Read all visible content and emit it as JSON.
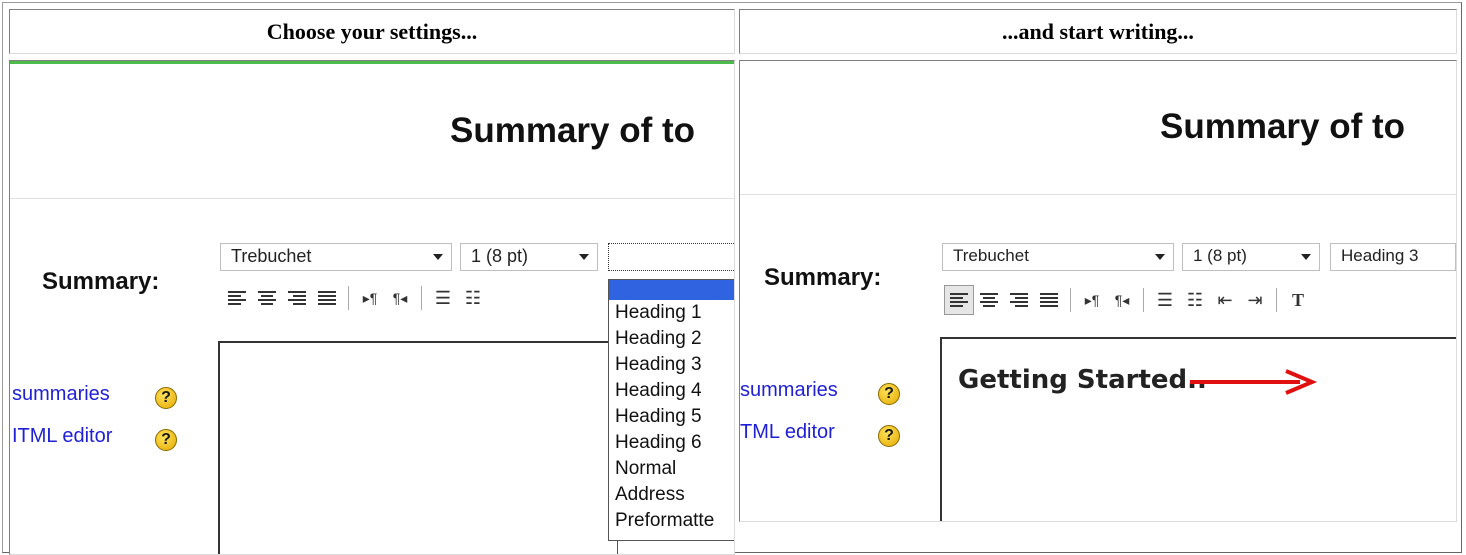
{
  "left_panel": {
    "header": "Choose your settings...",
    "page_title": "Summary of to",
    "field_label": "Summary:",
    "font_select": "Trebuchet",
    "size_select": "1 (8 pt)",
    "format_select": "",
    "links": [
      {
        "label": "summaries"
      },
      {
        "label": "ITML editor"
      }
    ],
    "help_icon_glyph": "?",
    "dropdown_options": [
      "",
      "Heading 1",
      "Heading 2",
      "Heading 3",
      "Heading 4",
      "Heading 5",
      "Heading 6",
      "Normal",
      "Address",
      "Preformatte"
    ]
  },
  "right_panel": {
    "header": "...and start writing...",
    "page_title": "Summary of to",
    "field_label": "Summary:",
    "font_select": "Trebuchet",
    "size_select": "1 (8 pt)",
    "format_select": "Heading 3",
    "links": [
      {
        "label": "summaries"
      },
      {
        "label": "TML editor"
      }
    ],
    "help_icon_glyph": "?",
    "editor_text": "Getting Started..",
    "toolbar_extra_glyph": "T"
  },
  "colors": {
    "accent_line": "#4cbb4c",
    "link": "#1f1fd6",
    "selection": "#2f63e0",
    "annotation_arrow": "#e01010"
  }
}
